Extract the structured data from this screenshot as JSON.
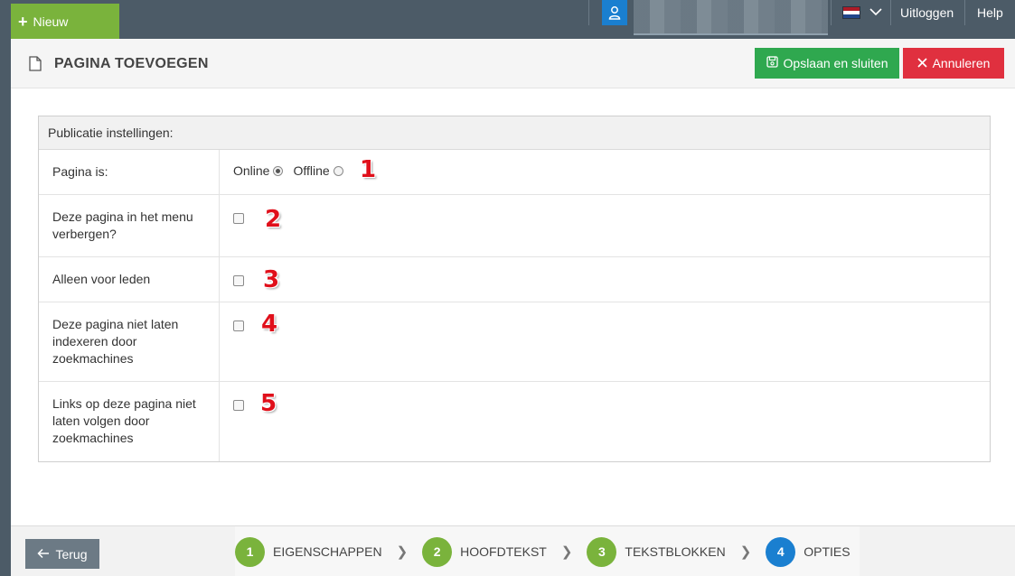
{
  "topbar": {
    "new_label": "Nieuw",
    "logout_label": "Uitloggen",
    "help_label": "Help"
  },
  "header": {
    "title": "PAGINA TOEVOEGEN",
    "save_label": "Opslaan en sluiten",
    "cancel_label": "Annuleren"
  },
  "settings": {
    "title": "Publicatie instellingen:",
    "rows": [
      {
        "label": "Pagina is:",
        "marker": "1"
      },
      {
        "label": "Deze pagina in het menu verbergen?",
        "marker": "2"
      },
      {
        "label": "Alleen voor leden",
        "marker": "3"
      },
      {
        "label": "Deze pagina niet laten indexeren door zoekmachines",
        "marker": "4"
      },
      {
        "label": "Links op deze pagina niet laten volgen door zoekmachines",
        "marker": "5"
      }
    ],
    "status_options": {
      "online": "Online",
      "offline": "Offline",
      "selected": "Online"
    }
  },
  "footer": {
    "back_label": "Terug",
    "steps": [
      {
        "num": "1",
        "label": "EIGENSCHAPPEN"
      },
      {
        "num": "2",
        "label": "HOOFDTEKST"
      },
      {
        "num": "3",
        "label": "TEKSTBLOKKEN"
      },
      {
        "num": "4",
        "label": "OPTIES"
      }
    ]
  },
  "colors": {
    "topbar_bg": "#4c5b67",
    "new_button": "#7ab33c",
    "save_button": "#2fa84f",
    "cancel_button": "#e0303f",
    "step_done": "#7ab33c",
    "step_active": "#1a7fd0",
    "marker_red": "#e0101b"
  },
  "icons": {
    "user": "user-icon",
    "flag": "netherlands-flag-icon",
    "document": "document-icon",
    "save": "save-icon",
    "close": "close-icon",
    "back": "arrow-left-icon"
  }
}
